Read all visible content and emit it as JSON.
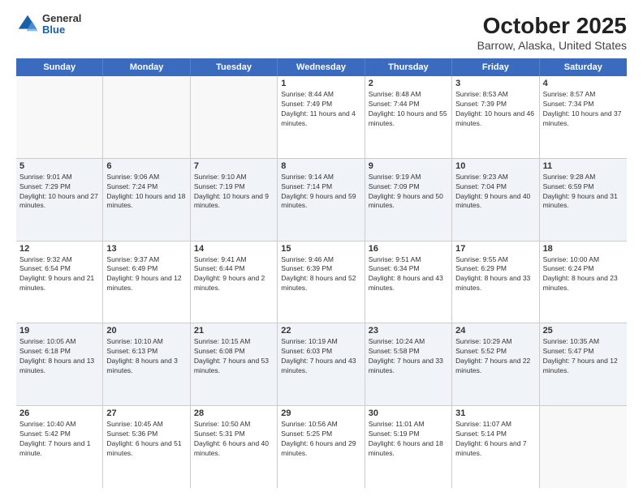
{
  "header": {
    "logo": {
      "line1": "General",
      "line2": "Blue"
    },
    "title": "October 2025",
    "subtitle": "Barrow, Alaska, United States"
  },
  "calendar": {
    "days_of_week": [
      "Sunday",
      "Monday",
      "Tuesday",
      "Wednesday",
      "Thursday",
      "Friday",
      "Saturday"
    ],
    "weeks": [
      [
        {
          "day": "",
          "info": ""
        },
        {
          "day": "",
          "info": ""
        },
        {
          "day": "",
          "info": ""
        },
        {
          "day": "1",
          "sunrise": "Sunrise: 8:44 AM",
          "sunset": "Sunset: 7:49 PM",
          "daylight": "Daylight: 11 hours and 4 minutes."
        },
        {
          "day": "2",
          "sunrise": "Sunrise: 8:48 AM",
          "sunset": "Sunset: 7:44 PM",
          "daylight": "Daylight: 10 hours and 55 minutes."
        },
        {
          "day": "3",
          "sunrise": "Sunrise: 8:53 AM",
          "sunset": "Sunset: 7:39 PM",
          "daylight": "Daylight: 10 hours and 46 minutes."
        },
        {
          "day": "4",
          "sunrise": "Sunrise: 8:57 AM",
          "sunset": "Sunset: 7:34 PM",
          "daylight": "Daylight: 10 hours and 37 minutes."
        }
      ],
      [
        {
          "day": "5",
          "sunrise": "Sunrise: 9:01 AM",
          "sunset": "Sunset: 7:29 PM",
          "daylight": "Daylight: 10 hours and 27 minutes."
        },
        {
          "day": "6",
          "sunrise": "Sunrise: 9:06 AM",
          "sunset": "Sunset: 7:24 PM",
          "daylight": "Daylight: 10 hours and 18 minutes."
        },
        {
          "day": "7",
          "sunrise": "Sunrise: 9:10 AM",
          "sunset": "Sunset: 7:19 PM",
          "daylight": "Daylight: 10 hours and 9 minutes."
        },
        {
          "day": "8",
          "sunrise": "Sunrise: 9:14 AM",
          "sunset": "Sunset: 7:14 PM",
          "daylight": "Daylight: 9 hours and 59 minutes."
        },
        {
          "day": "9",
          "sunrise": "Sunrise: 9:19 AM",
          "sunset": "Sunset: 7:09 PM",
          "daylight": "Daylight: 9 hours and 50 minutes."
        },
        {
          "day": "10",
          "sunrise": "Sunrise: 9:23 AM",
          "sunset": "Sunset: 7:04 PM",
          "daylight": "Daylight: 9 hours and 40 minutes."
        },
        {
          "day": "11",
          "sunrise": "Sunrise: 9:28 AM",
          "sunset": "Sunset: 6:59 PM",
          "daylight": "Daylight: 9 hours and 31 minutes."
        }
      ],
      [
        {
          "day": "12",
          "sunrise": "Sunrise: 9:32 AM",
          "sunset": "Sunset: 6:54 PM",
          "daylight": "Daylight: 9 hours and 21 minutes."
        },
        {
          "day": "13",
          "sunrise": "Sunrise: 9:37 AM",
          "sunset": "Sunset: 6:49 PM",
          "daylight": "Daylight: 9 hours and 12 minutes."
        },
        {
          "day": "14",
          "sunrise": "Sunrise: 9:41 AM",
          "sunset": "Sunset: 6:44 PM",
          "daylight": "Daylight: 9 hours and 2 minutes."
        },
        {
          "day": "15",
          "sunrise": "Sunrise: 9:46 AM",
          "sunset": "Sunset: 6:39 PM",
          "daylight": "Daylight: 8 hours and 52 minutes."
        },
        {
          "day": "16",
          "sunrise": "Sunrise: 9:51 AM",
          "sunset": "Sunset: 6:34 PM",
          "daylight": "Daylight: 8 hours and 43 minutes."
        },
        {
          "day": "17",
          "sunrise": "Sunrise: 9:55 AM",
          "sunset": "Sunset: 6:29 PM",
          "daylight": "Daylight: 8 hours and 33 minutes."
        },
        {
          "day": "18",
          "sunrise": "Sunrise: 10:00 AM",
          "sunset": "Sunset: 6:24 PM",
          "daylight": "Daylight: 8 hours and 23 minutes."
        }
      ],
      [
        {
          "day": "19",
          "sunrise": "Sunrise: 10:05 AM",
          "sunset": "Sunset: 6:18 PM",
          "daylight": "Daylight: 8 hours and 13 minutes."
        },
        {
          "day": "20",
          "sunrise": "Sunrise: 10:10 AM",
          "sunset": "Sunset: 6:13 PM",
          "daylight": "Daylight: 8 hours and 3 minutes."
        },
        {
          "day": "21",
          "sunrise": "Sunrise: 10:15 AM",
          "sunset": "Sunset: 6:08 PM",
          "daylight": "Daylight: 7 hours and 53 minutes."
        },
        {
          "day": "22",
          "sunrise": "Sunrise: 10:19 AM",
          "sunset": "Sunset: 6:03 PM",
          "daylight": "Daylight: 7 hours and 43 minutes."
        },
        {
          "day": "23",
          "sunrise": "Sunrise: 10:24 AM",
          "sunset": "Sunset: 5:58 PM",
          "daylight": "Daylight: 7 hours and 33 minutes."
        },
        {
          "day": "24",
          "sunrise": "Sunrise: 10:29 AM",
          "sunset": "Sunset: 5:52 PM",
          "daylight": "Daylight: 7 hours and 22 minutes."
        },
        {
          "day": "25",
          "sunrise": "Sunrise: 10:35 AM",
          "sunset": "Sunset: 5:47 PM",
          "daylight": "Daylight: 7 hours and 12 minutes."
        }
      ],
      [
        {
          "day": "26",
          "sunrise": "Sunrise: 10:40 AM",
          "sunset": "Sunset: 5:42 PM",
          "daylight": "Daylight: 7 hours and 1 minute."
        },
        {
          "day": "27",
          "sunrise": "Sunrise: 10:45 AM",
          "sunset": "Sunset: 5:36 PM",
          "daylight": "Daylight: 6 hours and 51 minutes."
        },
        {
          "day": "28",
          "sunrise": "Sunrise: 10:50 AM",
          "sunset": "Sunset: 5:31 PM",
          "daylight": "Daylight: 6 hours and 40 minutes."
        },
        {
          "day": "29",
          "sunrise": "Sunrise: 10:56 AM",
          "sunset": "Sunset: 5:25 PM",
          "daylight": "Daylight: 6 hours and 29 minutes."
        },
        {
          "day": "30",
          "sunrise": "Sunrise: 11:01 AM",
          "sunset": "Sunset: 5:19 PM",
          "daylight": "Daylight: 6 hours and 18 minutes."
        },
        {
          "day": "31",
          "sunrise": "Sunrise: 11:07 AM",
          "sunset": "Sunset: 5:14 PM",
          "daylight": "Daylight: 6 hours and 7 minutes."
        },
        {
          "day": "",
          "info": ""
        }
      ]
    ]
  }
}
